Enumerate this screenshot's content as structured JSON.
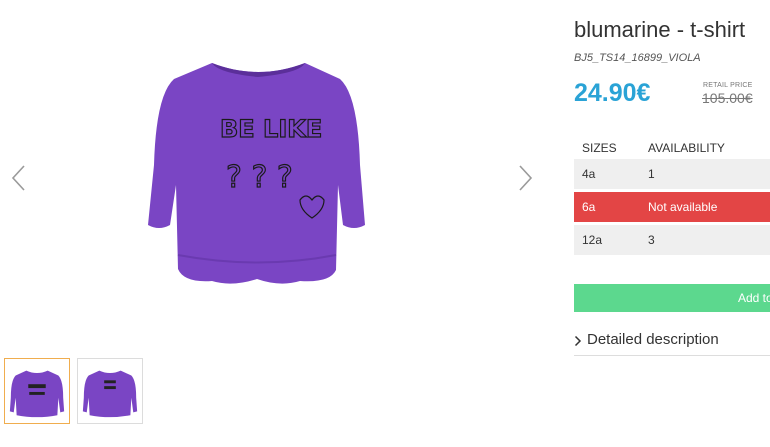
{
  "product": {
    "title": "blumarine - t-shirt",
    "sku": "BJ5_TS14_16899_VIOLA",
    "price": "24.90€",
    "retail_label": "RETAIL PRICE",
    "retail_price": "105.00€",
    "main_image_print": [
      "BE LIKE",
      "? ? ?"
    ]
  },
  "sizes_table": {
    "header_size": "SIZES",
    "header_availability": "AVAILABILITY",
    "rows": [
      {
        "size": "4a",
        "availability": "1",
        "available": true
      },
      {
        "size": "6a",
        "availability": "Not available",
        "available": false
      },
      {
        "size": "12a",
        "availability": "3",
        "available": true
      }
    ]
  },
  "actions": {
    "add_to_cart": "Add to"
  },
  "details": {
    "label": "Detailed description"
  },
  "colors": {
    "accent_price": "#2aa3d6",
    "unavailable": "#e34545",
    "add_button": "#5cd88e",
    "garment": "#7a45c4",
    "thumb_active_border": "#f0ad4e"
  },
  "icons": {
    "prev": "chevron-left-icon",
    "next": "chevron-right-icon",
    "detail": "chevron-right-icon"
  }
}
